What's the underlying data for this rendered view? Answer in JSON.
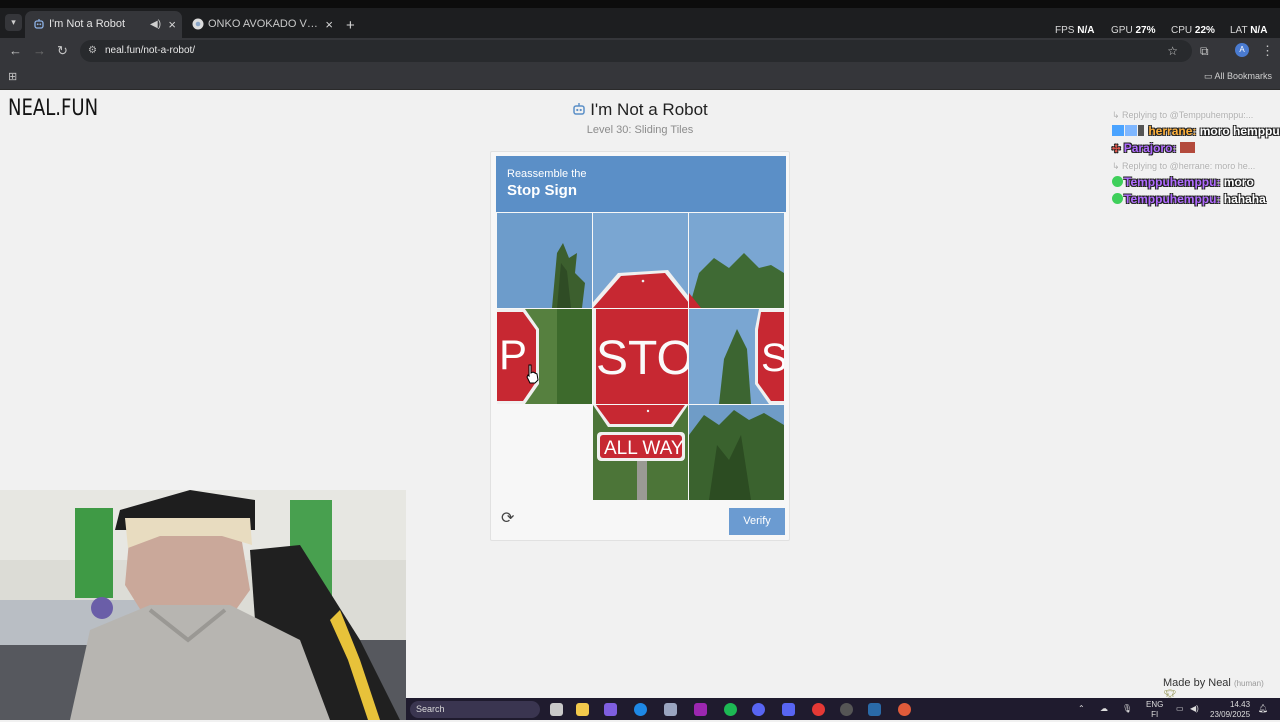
{
  "browser": {
    "tabs": [
      {
        "title": "I'm Not a Robot",
        "active": true,
        "icon": "robot-icon"
      },
      {
        "title": "ONKO AVOKADO VEGETABLE -",
        "active": false,
        "icon": "chrome-icon"
      }
    ],
    "url": "neal.fun/not-a-robot/",
    "bookmarks_label": "All Bookmarks",
    "profile_initial": "A"
  },
  "overlay_stats": {
    "fps_label": "FPS",
    "fps": "N/A",
    "gpu_label": "GPU",
    "gpu": "27",
    "cpu_label": "CPU",
    "cpu": "22",
    "lat_label": "LAT",
    "lat": "N/A"
  },
  "page": {
    "logo": "NEAL.FUN",
    "title": "I'm Not a Robot",
    "subtitle": "Level 30: Sliding Tiles"
  },
  "captcha": {
    "prompt": "Reassemble the",
    "target": "Stop Sign",
    "verify_label": "Verify",
    "refresh_icon": "refresh-icon",
    "header_color": "#5b8fc7",
    "button_color": "#6b9bd1",
    "tiles": [
      {
        "piece": "sky-tree-left",
        "slot": 0
      },
      {
        "piece": "sign-top",
        "slot": 1
      },
      {
        "piece": "sky-tree-right",
        "slot": 2
      },
      {
        "piece": "sign-right-edge",
        "slot": 3
      },
      {
        "piece": "sign-middle-sto",
        "slot": 4
      },
      {
        "piece": "sky-sign-left-edge",
        "slot": 5
      },
      {
        "piece": "empty",
        "slot": 6
      },
      {
        "piece": "sign-bottom-allway",
        "slot": 7
      },
      {
        "piece": "trees-bottom",
        "slot": 8
      }
    ]
  },
  "chat": [
    {
      "type": "reply",
      "text": "Replying to @Temppuhemppu:..."
    },
    {
      "type": "msg",
      "user": "herrane:",
      "text": "moro hemppu"
    },
    {
      "type": "msg",
      "user": "Parajoro:",
      "text": ""
    },
    {
      "type": "reply",
      "text": "Replying to @herrane: moro he..."
    },
    {
      "type": "msg",
      "user": "Temppuhemppu:",
      "text": "moro"
    },
    {
      "type": "msg",
      "user": "Temppuhemppu:",
      "text": "hahaha"
    }
  ],
  "footer": {
    "made_by": "Made by Neal",
    "made_by_note": "(human)"
  },
  "taskbar": {
    "search_placeholder": "Search",
    "lang_top": "ENG",
    "lang_bottom": "FI",
    "time": "14.43",
    "date": "23/09/2025"
  }
}
